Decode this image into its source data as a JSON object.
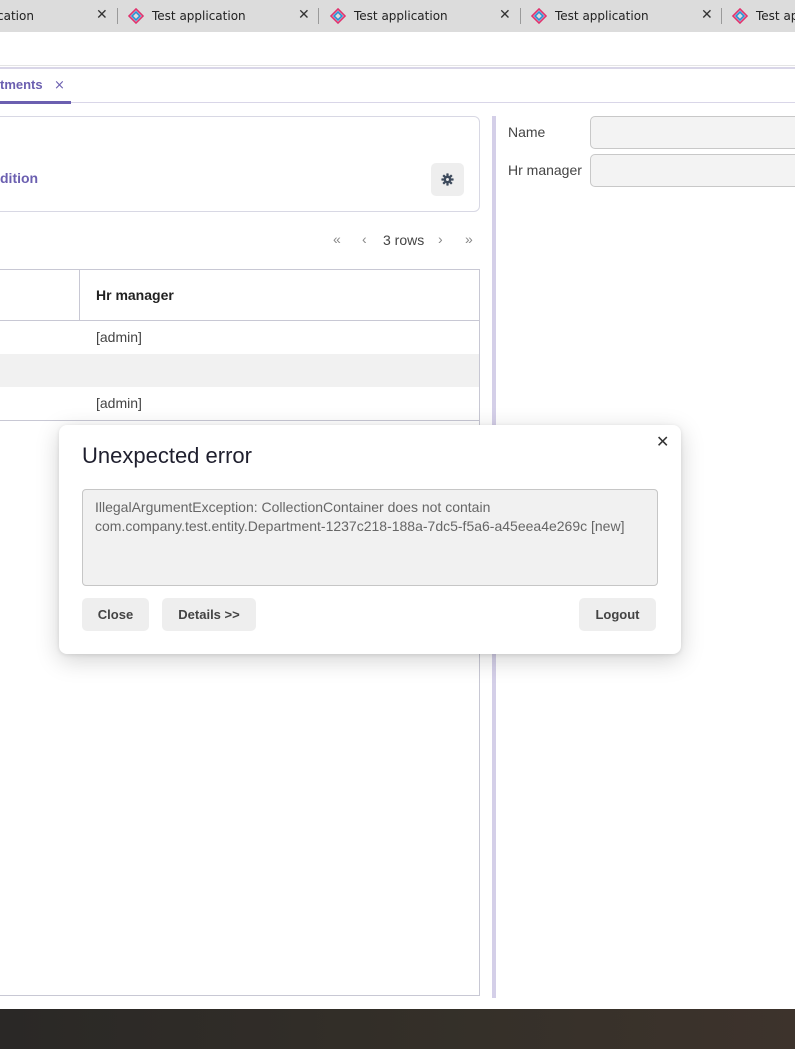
{
  "browser": {
    "tabs": [
      {
        "title": "cation"
      },
      {
        "title": "Test application"
      },
      {
        "title": "Test application"
      },
      {
        "title": "Test application"
      },
      {
        "title": "Test app"
      }
    ],
    "close_glyph": "✕"
  },
  "app_tabs": {
    "active_label": "tments",
    "close_glyph": "×"
  },
  "filter": {
    "add_condition_label": "dition",
    "settings_icon": "gear-icon"
  },
  "pager": {
    "first_glyph": "«",
    "prev_glyph": "‹",
    "rows_label": "3 rows",
    "next_glyph": "›",
    "last_glyph": "»"
  },
  "table": {
    "columns": [
      "Hr manager"
    ],
    "rows": [
      {
        "hr_manager": "[admin]"
      },
      {
        "hr_manager": ""
      },
      {
        "hr_manager": "[admin]"
      }
    ]
  },
  "form": {
    "name_label": "Name",
    "name_value": "",
    "hr_manager_label": "Hr manager",
    "hr_manager_value": ""
  },
  "dialog": {
    "title": "Unexpected error",
    "close_glyph": "✕",
    "message": "IllegalArgumentException: CollectionContainer does not contain com.company.test.entity.Department-1237c218-188a-7dc5-f5a6-a45eea4e269c [new]",
    "buttons": {
      "close": "Close",
      "details": "Details >>",
      "logout": "Logout"
    }
  },
  "colors": {
    "accent": "#6b5fb0",
    "tabstrip": "#dcdcdc",
    "button_bg": "#eeeeee"
  }
}
